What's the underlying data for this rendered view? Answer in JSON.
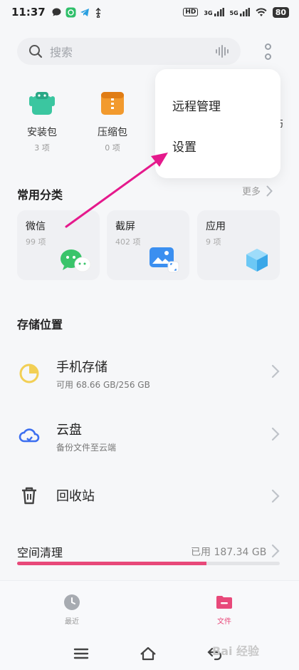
{
  "status": {
    "time": "11:37",
    "hd": "HD",
    "net1": "3G",
    "net2": "5G",
    "battery": "80"
  },
  "search": {
    "placeholder": "搜索"
  },
  "quick_items": [
    {
      "label": "安装包",
      "count": "3 项"
    },
    {
      "label": "压缩包",
      "count": "0 项"
    }
  ],
  "quick_cut_text": "伤",
  "popup_menu": {
    "items": [
      "远程管理",
      "设置"
    ]
  },
  "categories": {
    "title": "常用分类",
    "more": "更多",
    "items": [
      {
        "name": "微信",
        "count": "99 项"
      },
      {
        "name": "截屏",
        "count": "402 项"
      },
      {
        "name": "应用",
        "count": "9 项"
      }
    ]
  },
  "storage": {
    "title": "存储位置",
    "items": [
      {
        "title": "手机存储",
        "sub": "可用 68.66 GB/256 GB"
      },
      {
        "title": "云盘",
        "sub": "备份文件至云端"
      },
      {
        "title": "回收站",
        "sub": ""
      }
    ]
  },
  "cleanup": {
    "title": "空间清理",
    "used": "已用 187.34 GB",
    "fill_fraction": 0.72
  },
  "bottom_nav": {
    "recent": "最近",
    "files": "文件"
  },
  "watermark": "Bai 经验",
  "colors": {
    "accent": "#e8497a",
    "wechat": "#3ac46a",
    "apk": "#3bc6a0",
    "zip": "#f29a2e",
    "screenshot": "#3b8ff0",
    "app": "#4fb6f0",
    "storage_icon": "#f2cf55",
    "cloud_icon": "#3d6ff0"
  }
}
